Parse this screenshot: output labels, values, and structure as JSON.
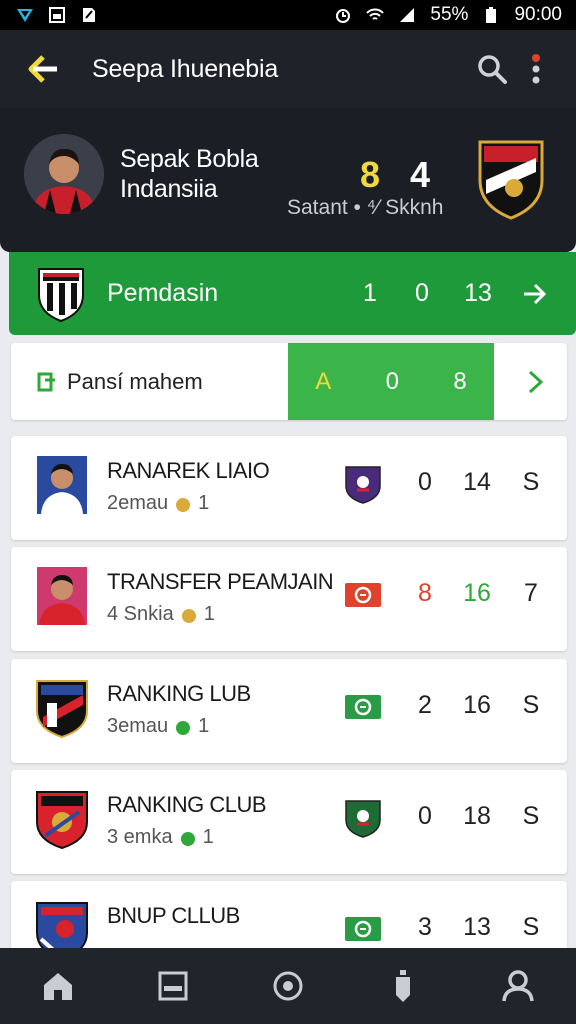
{
  "status_bar": {
    "battery": "55%",
    "time": "90:00"
  },
  "app_bar": {
    "title": "Seepa Ihuenebia",
    "back_icon": "back-arrow-icon",
    "search_icon": "search-icon",
    "more_icon": "more-vert-icon"
  },
  "match": {
    "name_line1": "Sepak Bobla",
    "name_line2": "Indansiia",
    "score_home": "8",
    "score_away": "4",
    "subtitle": "Satant • ⁴⁄ Skknh"
  },
  "highlight": {
    "label": "Pemdasin",
    "v1": "1",
    "v2": "0",
    "v3": "13"
  },
  "pansi": {
    "label": "Pansí mahem",
    "v1": "A",
    "v2": "0",
    "v3": "8"
  },
  "cards": [
    {
      "title": "RANAREK LIAIO",
      "sub": "2emau",
      "sub_count": "1",
      "c1": "0",
      "c2": "14",
      "c3": "S",
      "c1_color": "#222222",
      "c2_color": "#222222",
      "badge": "shield-purple",
      "badge_color": "#4a2a7a"
    },
    {
      "title": "TRANSFER PEAMJAIN",
      "sub": "4 Snkia",
      "sub_count": "1",
      "c1": "8",
      "c2": "16",
      "c3": "7",
      "c1_color": "#e0422c",
      "c2_color": "#2fa83a",
      "badge": "cash-red",
      "badge_color": "#e0422c"
    },
    {
      "title": "RANKING LUB",
      "sub": "3emau",
      "sub_count": "1",
      "c1": "2",
      "c2": "16",
      "c3": "S",
      "c1_color": "#222222",
      "c2_color": "#222222",
      "badge": "cash-green",
      "badge_color": "#2a9c45"
    },
    {
      "title": "RANKING CLUB",
      "sub": "3 emka",
      "sub_count": "1",
      "c1": "0",
      "c2": "18",
      "c3": "S",
      "c1_color": "#222222",
      "c2_color": "#222222",
      "badge": "shield-green",
      "badge_color": "#1f6b35"
    },
    {
      "title": "BNUP CLLUB",
      "sub": "",
      "sub_count": "",
      "c1": "3",
      "c2": "13",
      "c3": "S",
      "c1_color": "#222222",
      "c2_color": "#222222",
      "badge": "cash-green",
      "badge_color": "#2a9c45"
    }
  ],
  "bottom_nav": [
    "home-icon",
    "list-icon",
    "record-icon",
    "bottle-icon",
    "profile-icon"
  ]
}
